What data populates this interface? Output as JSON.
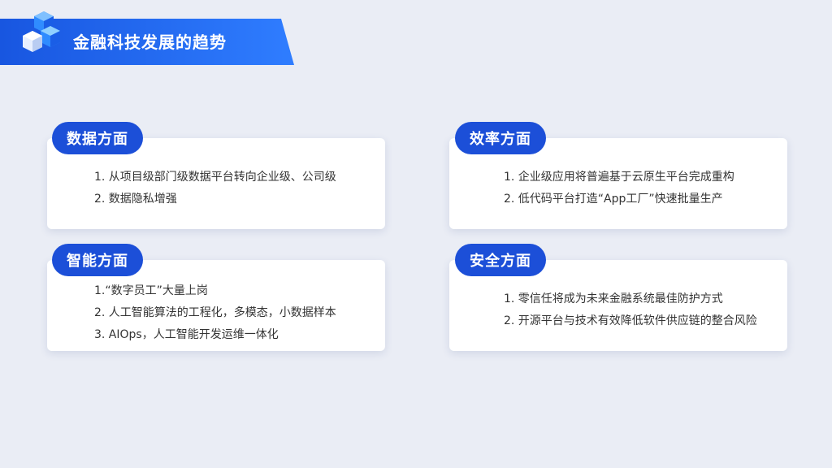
{
  "header": {
    "title": "金融科技发展的趋势"
  },
  "cards": [
    {
      "label": "数据方面",
      "items": [
        "1. 从项目级部门级数据平台转向企业级、公司级",
        "2. 数据隐私增强"
      ]
    },
    {
      "label": "效率方面",
      "items": [
        "1. 企业级应用将普遍基于云原生平台完成重构",
        "2. 低代码平台打造“App工厂”快速批量生产"
      ]
    },
    {
      "label": "智能方面",
      "items": [
        "1.“数字员工”大量上岗",
        "2.  人工智能算法的工程化，多模态，小数据样本",
        "3.  AIOps，人工智能开发运维一体化"
      ]
    },
    {
      "label": "安全方面",
      "items": [
        "1. 零信任将成为未来金融系统最佳防护方式",
        "2. 开源平台与技术有效降低软件供应链的整合风险"
      ]
    }
  ],
  "colors": {
    "accent": "#1c4fd8",
    "header_start": "#1856e0",
    "header_end": "#2f7dff",
    "background": "#eaedf5"
  }
}
